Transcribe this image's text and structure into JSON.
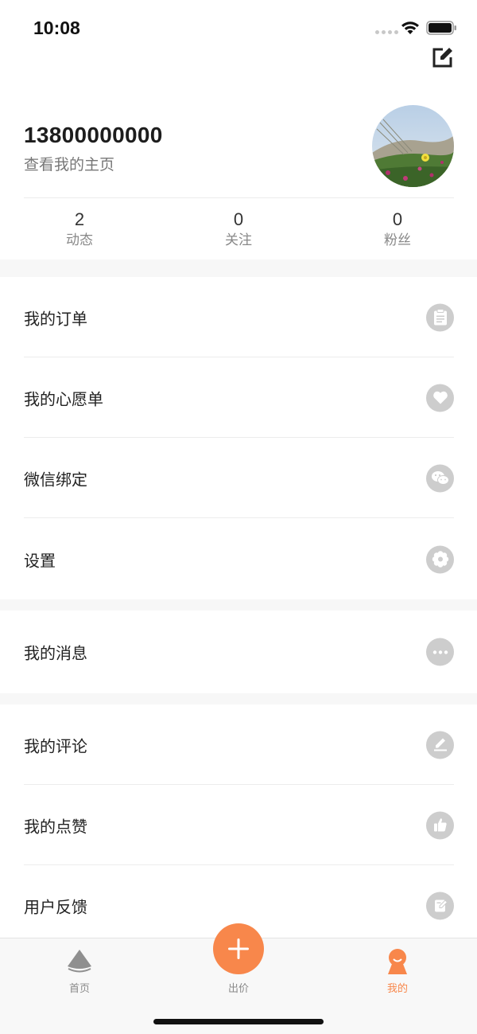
{
  "status_bar": {
    "time": "10:08"
  },
  "profile": {
    "phone": "13800000000",
    "homepage_link": "查看我的主页"
  },
  "stats": [
    {
      "value": "2",
      "label": "动态"
    },
    {
      "value": "0",
      "label": "关注"
    },
    {
      "value": "0",
      "label": "粉丝"
    }
  ],
  "menu": {
    "group1": [
      {
        "label": "我的订单",
        "icon": "clipboard-icon"
      },
      {
        "label": "我的心愿单",
        "icon": "heart-icon"
      },
      {
        "label": "微信绑定",
        "icon": "wechat-icon"
      },
      {
        "label": "设置",
        "icon": "gear-icon"
      }
    ],
    "group2": [
      {
        "label": "我的消息",
        "icon": "more-icon"
      }
    ],
    "group3": [
      {
        "label": "我的评论",
        "icon": "pen-icon"
      },
      {
        "label": "我的点赞",
        "icon": "thumbs-up-icon"
      },
      {
        "label": "用户反馈",
        "icon": "feedback-icon"
      }
    ]
  },
  "tabs": [
    {
      "label": "首页",
      "icon": "home-icon"
    },
    {
      "label": "出价",
      "icon": "plus-icon"
    },
    {
      "label": "我的",
      "icon": "profile-icon"
    }
  ],
  "colors": {
    "accent": "#f8874b",
    "icon_gray": "#cdcdcd",
    "section_gap": "#f7f7f7"
  }
}
